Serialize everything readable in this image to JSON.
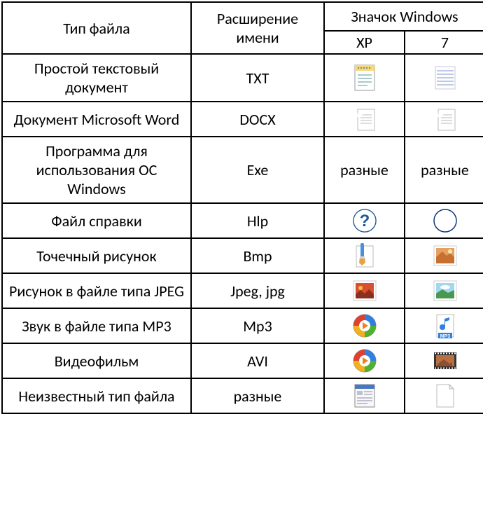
{
  "header": {
    "filetype": "Тип файла",
    "extension": "Расширение имени",
    "icon_header": "Значок Windows",
    "xp": "XP",
    "seven": "7"
  },
  "rows": [
    {
      "filetype": "Простой текстовый документ",
      "ext": "TXT",
      "xp_icon": "notepad-xp",
      "seven_icon": "notepad-7"
    },
    {
      "filetype": "Документ Microsoft Word",
      "ext": "DOCX",
      "xp_icon": "word-xp",
      "seven_icon": "word-7"
    },
    {
      "filetype": "Программа для использования ОС Windows",
      "ext": "Exe",
      "xp_text": "разные",
      "seven_text": "разные"
    },
    {
      "filetype": "Файл справки",
      "ext": "Hlp",
      "xp_icon": "help-xp",
      "seven_icon": "help-7"
    },
    {
      "filetype": "Точечный рисунок",
      "ext": "Bmp",
      "xp_icon": "bmp-xp",
      "seven_icon": "bmp-7"
    },
    {
      "filetype": "Рисунок в файле типа JPEG",
      "ext": "Jpeg, jpg",
      "xp_icon": "jpeg-xp",
      "seven_icon": "jpeg-7"
    },
    {
      "filetype": "Звук в файле типа MP3",
      "ext": "Mp3",
      "xp_icon": "mp3-xp",
      "seven_icon": "mp3-7"
    },
    {
      "filetype": "Видеофильм",
      "ext": "AVI",
      "xp_icon": "avi-xp",
      "seven_icon": "avi-7"
    },
    {
      "filetype": "Неизвестный тип файла",
      "ext": "разные",
      "xp_icon": "unknown-xp",
      "seven_icon": "unknown-7"
    }
  ]
}
